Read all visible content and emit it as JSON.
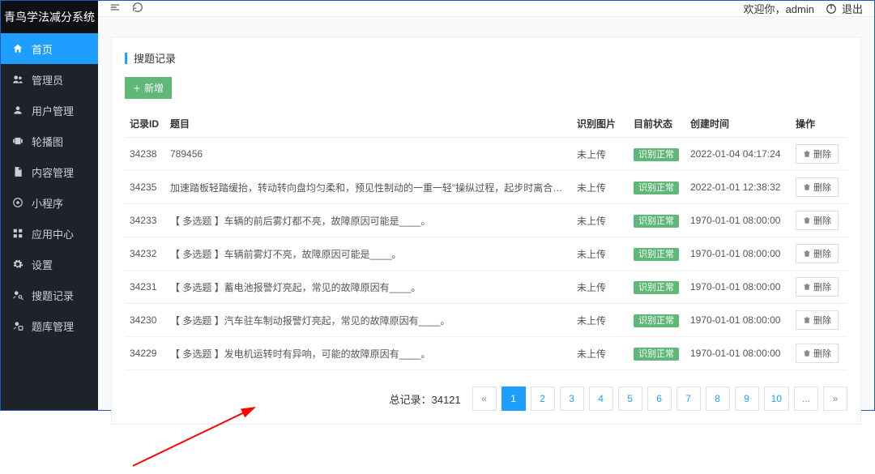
{
  "brand": "青鸟学法减分系统",
  "sidebar": {
    "items": [
      {
        "label": "首页",
        "icon": "home",
        "active": true
      },
      {
        "label": "管理员",
        "icon": "users"
      },
      {
        "label": "用户管理",
        "icon": "user"
      },
      {
        "label": "轮播图",
        "icon": "carousel"
      },
      {
        "label": "内容管理",
        "icon": "file"
      },
      {
        "label": "小程序",
        "icon": "app"
      },
      {
        "label": "应用中心",
        "icon": "grid"
      },
      {
        "label": "设置",
        "icon": "gear"
      },
      {
        "label": "搜题记录",
        "icon": "search-user"
      },
      {
        "label": "题库管理",
        "icon": "db"
      }
    ]
  },
  "header": {
    "welcome_prefix": "欢迎你，",
    "username": "admin",
    "logout_label": "退出"
  },
  "panel": {
    "title": "搜题记录",
    "add_label": "新增"
  },
  "table": {
    "headers": {
      "id": "记录ID",
      "topic": "题目",
      "img": "识别图片",
      "status": "目前状态",
      "time": "创建时间",
      "op": "操作"
    },
    "img_not_uploaded": "未上传",
    "status_badge": "识别正常",
    "delete_label": "删除",
    "rows": [
      {
        "id": "34238",
        "topic": "789456",
        "time": "2022-01-04 04:17:24"
      },
      {
        "id": "34235",
        "topic": "加速踏板轻踏缓抬，转动转向盘均匀柔和，预见性制动的一重一轻\"操纵过程，起步时离合器平稳结合等，都是对动作柔和的要求。",
        "time": "2022-01-01 12:38:32"
      },
      {
        "id": "34233",
        "topic": "【 多选题 】车辆的前后雾灯都不亮，故障原因可能是____。",
        "time": "1970-01-01 08:00:00"
      },
      {
        "id": "34232",
        "topic": "【 多选题 】车辆前雾灯不亮，故障原因可能是____。",
        "time": "1970-01-01 08:00:00"
      },
      {
        "id": "34231",
        "topic": "【 多选题 】蓄电池报警灯亮起，常见的故障原因有____。",
        "time": "1970-01-01 08:00:00"
      },
      {
        "id": "34230",
        "topic": "【 多选题 】汽车驻车制动报警灯亮起，常见的故障原因有____。",
        "time": "1970-01-01 08:00:00"
      },
      {
        "id": "34229",
        "topic": "【 多选题 】发电机运转时有异响，可能的故障原因有____。",
        "time": "1970-01-01 08:00:00"
      }
    ]
  },
  "pagination": {
    "total_label": "总记录：",
    "total": "34121",
    "prev": "«",
    "next": "»",
    "ellipsis": "...",
    "pages": [
      "1",
      "2",
      "3",
      "4",
      "5",
      "6",
      "7",
      "8",
      "9",
      "10"
    ],
    "active_page": "1"
  }
}
